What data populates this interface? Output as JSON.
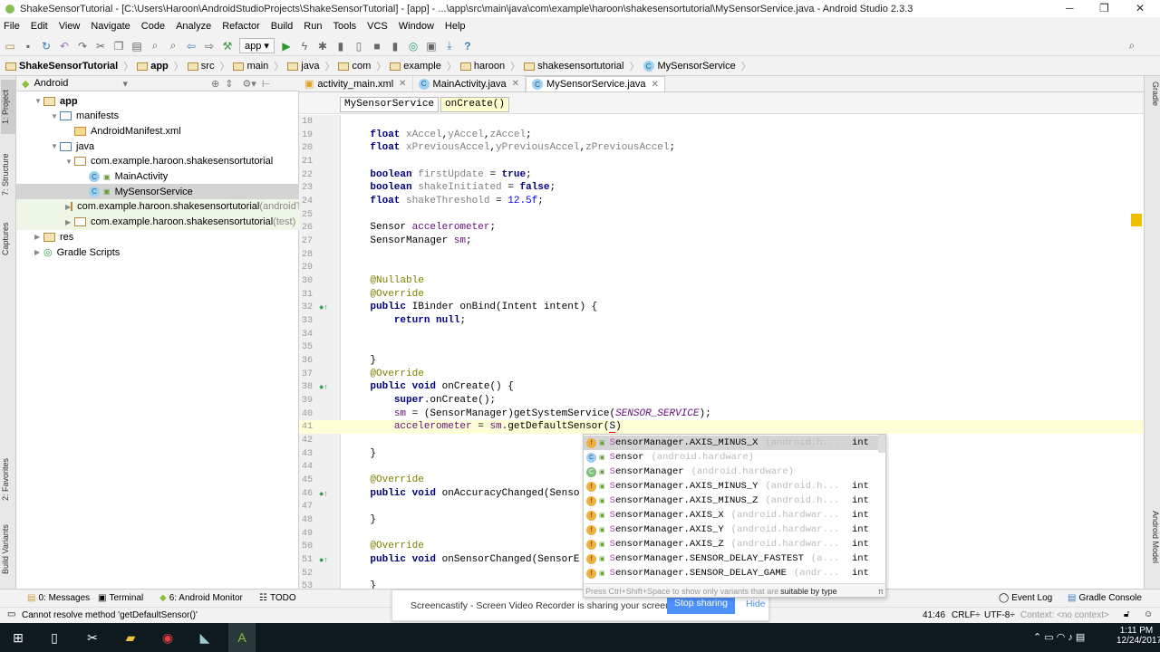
{
  "title": "ShakeSensorTutorial - [C:\\Users\\Haroon\\AndroidStudioProjects\\ShakeSensorTutorial] - [app] - ...\\app\\src\\main\\java\\com\\example\\haroon\\shakesensortutorial\\MySensorService.java - Android Studio 2.3.3",
  "window_controls": {
    "minimize": "─",
    "maximize": "❐",
    "close": "✕"
  },
  "menu": [
    "File",
    "Edit",
    "View",
    "Navigate",
    "Code",
    "Analyze",
    "Refactor",
    "Build",
    "Run",
    "Tools",
    "VCS",
    "Window",
    "Help"
  ],
  "toolbar": {
    "run_config": "app",
    "help": "?"
  },
  "breadcrumbs": [
    "ShakeSensorTutorial",
    "app",
    "src",
    "main",
    "java",
    "com",
    "example",
    "haroon",
    "shakesensortutorial",
    "MySensorService"
  ],
  "project_panel": {
    "view": "Android",
    "tree": [
      {
        "label": "app",
        "suffix": ""
      },
      {
        "label": "manifests",
        "suffix": ""
      },
      {
        "label": "AndroidManifest.xml",
        "suffix": ""
      },
      {
        "label": "java",
        "suffix": ""
      },
      {
        "label": "com.example.haroon.shakesensortutorial",
        "suffix": ""
      },
      {
        "label": "MainActivity",
        "suffix": ""
      },
      {
        "label": "MySensorService",
        "suffix": ""
      },
      {
        "label": "com.example.haroon.shakesensortutorial",
        "suffix": " (androidTest)"
      },
      {
        "label": "com.example.haroon.shakesensortutorial",
        "suffix": " (test)"
      },
      {
        "label": "res",
        "suffix": ""
      },
      {
        "label": "Gradle Scripts",
        "suffix": ""
      }
    ]
  },
  "left_tool_tabs": [
    "1: Project",
    "7: Structure",
    "Captures",
    "2: Favorites",
    "Build Variants"
  ],
  "right_tool_tabs": [
    "Gradle",
    "Android Model"
  ],
  "editor_tabs": [
    {
      "label": "activity_main.xml",
      "active": false
    },
    {
      "label": "MainActivity.java",
      "active": false
    },
    {
      "label": "MySensorService.java",
      "active": true
    }
  ],
  "editor_breadcrumb": [
    "MySensorService",
    "onCreate()"
  ],
  "code": [
    {
      "n": "18",
      "t": []
    },
    {
      "n": "19",
      "t": [
        [
          "    ",
          ""
        ],
        [
          "float",
          "kw"
        ],
        [
          " ",
          ""
        ],
        [
          "xAccel",
          "unused"
        ],
        [
          ",",
          ""
        ],
        [
          "yAccel",
          "unused"
        ],
        [
          ",",
          ""
        ],
        [
          "zAccel",
          "unused"
        ],
        [
          ";",
          ""
        ]
      ]
    },
    {
      "n": "20",
      "t": [
        [
          "    ",
          ""
        ],
        [
          "float",
          "kw"
        ],
        [
          " ",
          ""
        ],
        [
          "xPreviousAccel",
          "unused"
        ],
        [
          ",",
          ""
        ],
        [
          "yPreviousAccel",
          "unused"
        ],
        [
          ",",
          ""
        ],
        [
          "zPreviousAccel",
          "unused"
        ],
        [
          ";",
          ""
        ]
      ]
    },
    {
      "n": "21",
      "t": []
    },
    {
      "n": "22",
      "t": [
        [
          "    ",
          ""
        ],
        [
          "boolean",
          "kw"
        ],
        [
          " ",
          ""
        ],
        [
          "firstUpdate",
          "unused"
        ],
        [
          " = ",
          ""
        ],
        [
          "true",
          "kw"
        ],
        [
          ";",
          ""
        ]
      ]
    },
    {
      "n": "23",
      "t": [
        [
          "    ",
          ""
        ],
        [
          "boolean",
          "kw"
        ],
        [
          " ",
          ""
        ],
        [
          "shakeInitiated",
          "unused"
        ],
        [
          " = ",
          ""
        ],
        [
          "false",
          "kw"
        ],
        [
          ";",
          ""
        ]
      ]
    },
    {
      "n": "24",
      "t": [
        [
          "    ",
          ""
        ],
        [
          "float",
          "kw"
        ],
        [
          " ",
          ""
        ],
        [
          "shakeThreshold",
          "unused"
        ],
        [
          " = ",
          ""
        ],
        [
          "12.5f",
          "num"
        ],
        [
          ";",
          ""
        ]
      ]
    },
    {
      "n": "25",
      "t": []
    },
    {
      "n": "26",
      "t": [
        [
          "    Sensor ",
          ""
        ],
        [
          "accelerometer",
          "fld"
        ],
        [
          ";",
          ""
        ]
      ]
    },
    {
      "n": "27",
      "t": [
        [
          "    SensorManager ",
          ""
        ],
        [
          "sm",
          "fld"
        ],
        [
          ";",
          ""
        ]
      ]
    },
    {
      "n": "28",
      "t": []
    },
    {
      "n": "29",
      "t": []
    },
    {
      "n": "30",
      "t": [
        [
          "    ",
          ""
        ],
        [
          "@Nullable",
          "ann"
        ]
      ]
    },
    {
      "n": "31",
      "t": [
        [
          "    ",
          ""
        ],
        [
          "@Override",
          "ann"
        ]
      ]
    },
    {
      "n": "32",
      "t": [
        [
          "    ",
          ""
        ],
        [
          "public",
          "kw"
        ],
        [
          " IBinder onBind(Intent intent) {",
          ""
        ]
      ]
    },
    {
      "n": "33",
      "t": [
        [
          "        ",
          ""
        ],
        [
          "return null",
          "kw"
        ],
        [
          ";",
          ""
        ]
      ]
    },
    {
      "n": "34",
      "t": []
    },
    {
      "n": "35",
      "t": []
    },
    {
      "n": "36",
      "t": [
        [
          "    }",
          ""
        ]
      ]
    },
    {
      "n": "37",
      "t": [
        [
          "    ",
          ""
        ],
        [
          "@Override",
          "ann"
        ]
      ]
    },
    {
      "n": "38",
      "t": [
        [
          "    ",
          ""
        ],
        [
          "public void",
          "kw"
        ],
        [
          " onCreate() {",
          ""
        ]
      ]
    },
    {
      "n": "39",
      "t": [
        [
          "        ",
          ""
        ],
        [
          "super",
          "kw"
        ],
        [
          ".onCreate();",
          ""
        ]
      ]
    },
    {
      "n": "40",
      "t": [
        [
          "        ",
          ""
        ],
        [
          "sm",
          "fld"
        ],
        [
          " = (SensorManager)getSystemService(",
          ""
        ],
        [
          "SENSOR_SERVICE",
          "const"
        ],
        [
          ");",
          ""
        ]
      ]
    },
    {
      "n": "41",
      "t": [
        [
          "        ",
          ""
        ],
        [
          "accelerometer",
          "fld"
        ],
        [
          " = ",
          ""
        ],
        [
          "sm",
          "fld"
        ],
        [
          ".getDefaultSensor(",
          ""
        ],
        [
          "S",
          "err"
        ],
        [
          ")",
          ""
        ]
      ],
      "current": true
    },
    {
      "n": "42",
      "t": []
    },
    {
      "n": "43",
      "t": [
        [
          "    }",
          ""
        ]
      ]
    },
    {
      "n": "44",
      "t": []
    },
    {
      "n": "45",
      "t": [
        [
          "    ",
          ""
        ],
        [
          "@Override",
          "ann"
        ]
      ]
    },
    {
      "n": "46",
      "t": [
        [
          "    ",
          ""
        ],
        [
          "public void",
          "kw"
        ],
        [
          " onAccuracyChanged(Senso",
          ""
        ]
      ]
    },
    {
      "n": "47",
      "t": []
    },
    {
      "n": "48",
      "t": [
        [
          "    }",
          ""
        ]
      ]
    },
    {
      "n": "49",
      "t": []
    },
    {
      "n": "50",
      "t": [
        [
          "    ",
          ""
        ],
        [
          "@Override",
          "ann"
        ]
      ]
    },
    {
      "n": "51",
      "t": [
        [
          "    ",
          ""
        ],
        [
          "public void",
          "kw"
        ],
        [
          " onSensorChanged(SensorE",
          ""
        ]
      ]
    },
    {
      "n": "52",
      "t": []
    },
    {
      "n": "53",
      "t": [
        [
          "    }",
          ""
        ]
      ]
    }
  ],
  "completion": {
    "items": [
      {
        "icon": "f",
        "name": "SensorManager.AXIS_MINUS_X",
        "pkg": "(android.h...",
        "type": "int"
      },
      {
        "icon": "c",
        "name": "Sensor",
        "pkg": "(android.hardware)",
        "type": ""
      },
      {
        "icon": "cg",
        "name": "SensorManager",
        "pkg": "(android.hardware)",
        "type": ""
      },
      {
        "icon": "f",
        "name": "SensorManager.AXIS_MINUS_Y",
        "pkg": "(android.h...",
        "type": "int"
      },
      {
        "icon": "f",
        "name": "SensorManager.AXIS_MINUS_Z",
        "pkg": "(android.h...",
        "type": "int"
      },
      {
        "icon": "f",
        "name": "SensorManager.AXIS_X",
        "pkg": "(android.hardwar...",
        "type": "int"
      },
      {
        "icon": "f",
        "name": "SensorManager.AXIS_Y",
        "pkg": "(android.hardwar...",
        "type": "int"
      },
      {
        "icon": "f",
        "name": "SensorManager.AXIS_Z",
        "pkg": "(android.hardwar...",
        "type": "int"
      },
      {
        "icon": "f",
        "name": "SensorManager.SENSOR_DELAY_FASTEST",
        "pkg": "(a...",
        "type": "int"
      },
      {
        "icon": "f",
        "name": "SensorManager.SENSOR_DELAY_GAME",
        "pkg": "(andr...",
        "type": "int"
      }
    ],
    "footer_hint": "Press Ctrl+Shift+Space to show only variants that are",
    "footer_link": "suitable by type",
    "footer_pi": "π"
  },
  "tool_windows": {
    "messages": "0: Messages",
    "terminal": "Terminal",
    "monitor": "6: Android Monitor",
    "todo": "TODO",
    "event_log": "Event Log",
    "gradle_console": "Gradle Console"
  },
  "notification": {
    "text": "Screencastify - Screen Video Recorder is sharing your screen.",
    "stop": "Stop sharing",
    "hide": "Hide"
  },
  "status": {
    "message": "Cannot resolve method 'getDefaultSensor()'",
    "position": "41:46",
    "line_sep": "CRLF÷",
    "encoding": "UTF-8÷",
    "context": "Context: <no context>"
  },
  "taskbar": {
    "time": "1:11 PM",
    "date": "12/24/2017"
  },
  "colors": {
    "taskbar": "#0f1a1f",
    "accent": "#4d90fe",
    "selection": "#d4d4d4",
    "current_line": "#ffffd7"
  }
}
